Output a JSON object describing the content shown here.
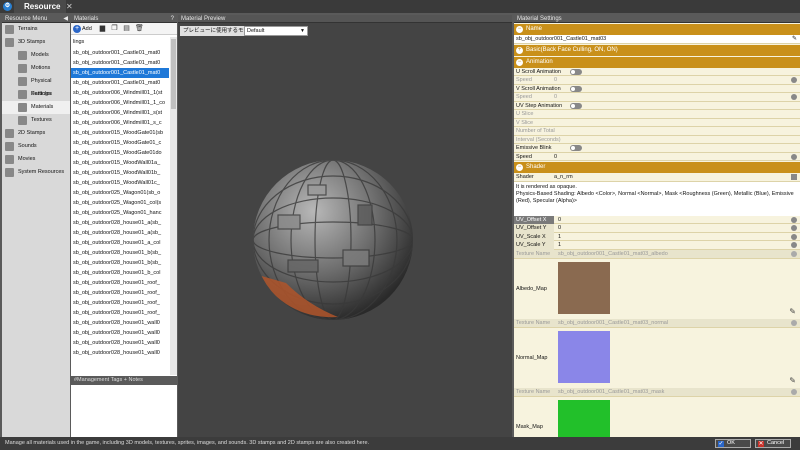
{
  "window": {
    "tab_title": "Resource",
    "close_glyph": "✕"
  },
  "resource_menu": {
    "title": "Resource Menu",
    "items": [
      {
        "label": "Terrains",
        "icon": "terrain-icon",
        "level": 0
      },
      {
        "label": "3D Stamps",
        "icon": "stamp-3d-icon",
        "level": 0
      },
      {
        "label": "Models",
        "icon": "model-icon",
        "level": 1
      },
      {
        "label": "Motions",
        "icon": "motion-icon",
        "level": 1
      },
      {
        "label": "Physical Settings",
        "icon": "physics-icon",
        "level": 1
      },
      {
        "label": "Particles",
        "icon": "particle-icon",
        "level": 1
      },
      {
        "label": "Materials",
        "icon": "material-icon",
        "level": 1,
        "selected": true
      },
      {
        "label": "Textures",
        "icon": "texture-icon",
        "level": 1
      },
      {
        "label": "2D Stamps",
        "icon": "stamp-2d-icon",
        "level": 0
      },
      {
        "label": "Sounds",
        "icon": "sound-icon",
        "level": 0
      },
      {
        "label": "Movies",
        "icon": "movie-icon",
        "level": 0
      },
      {
        "label": "System Resources",
        "icon": "system-icon",
        "level": 0
      }
    ]
  },
  "materials": {
    "title": "Materials",
    "help": "?",
    "add_label": "Add",
    "search_value": "lings",
    "items": [
      "sb_obj_outdoor001_Castle01_mat0",
      "sb_obj_outdoor001_Castle01_mat0",
      "sb_obj_outdoor001_Castle01_mat0",
      "sb_obj_outdoor001_Castle01_mat0",
      "sb_obj_outdoor006_Windmill01_1(st",
      "sb_obj_outdoor006_Windmill01_1_co",
      "sb_obj_outdoor006_Windmill01_s(st",
      "sb_obj_outdoor006_Windmill01_s_c",
      "sb_obj_outdoor015_WoodGate01(sb",
      "sb_obj_outdoor015_WoodGate01_c",
      "sb_obj_outdoor015_WoodGate01do",
      "sb_obj_outdoor015_WoodWall01a_",
      "sb_obj_outdoor015_WoodWall01b_",
      "sb_obj_outdoor015_WoodWall01c_",
      "sb_obj_outdoor025_Wagon01(sb_o",
      "sb_obj_outdoor025_Wagon01_col(s",
      "sb_obj_outdoor025_Wagon01_hanc",
      "sb_obj_outdoor028_house01_a(sb_",
      "sb_obj_outdoor028_house01_a(sb_",
      "sb_obj_outdoor028_house01_a_col",
      "sb_obj_outdoor028_house01_b(sb_",
      "sb_obj_outdoor028_house01_b(sb_",
      "sb_obj_outdoor028_house01_b_col",
      "sb_obj_outdoor028_house01_roof_",
      "sb_obj_outdoor028_house01_roof_",
      "sb_obj_outdoor028_house01_roof_",
      "sb_obj_outdoor028_house01_roof_",
      "sb_obj_outdoor028_house01_wall0",
      "sb_obj_outdoor028_house01_wall0",
      "sb_obj_outdoor028_house01_wall0",
      "sb_obj_outdoor028_house01_wall0"
    ],
    "selected_index": 2,
    "tags_label": "#Management Tags + Notes"
  },
  "preview": {
    "title": "Material Preview",
    "model_label": "プレビューに使用するモデル",
    "model_value": "Default"
  },
  "settings": {
    "title": "Material Settings",
    "name_section": "Name",
    "name_value": "sb_obj_outdoor001_Castle01_mat03",
    "basic_section": "Basic(Back Face Culling, ON, ON)",
    "animation_section": "Animation",
    "animation_rows": [
      {
        "label": "U Scroll Animation",
        "toggle": true,
        "disabled": false,
        "value": ""
      },
      {
        "label": "Speed",
        "toggle": false,
        "disabled": true,
        "value": "0"
      },
      {
        "label": "V Scroll Animation",
        "toggle": true,
        "disabled": false,
        "value": ""
      },
      {
        "label": "Speed",
        "toggle": false,
        "disabled": true,
        "value": "0"
      },
      {
        "label": "UV Step Animation",
        "toggle": true,
        "disabled": false,
        "value": ""
      },
      {
        "label": "U Slice",
        "toggle": false,
        "disabled": true,
        "value": ""
      },
      {
        "label": "V Slice",
        "toggle": false,
        "disabled": true,
        "value": ""
      },
      {
        "label": "Number of Total",
        "toggle": false,
        "disabled": true,
        "value": ""
      },
      {
        "label": "Interval (Seconds)",
        "toggle": false,
        "disabled": true,
        "value": ""
      },
      {
        "label": "Emissive Blink",
        "toggle": true,
        "disabled": false,
        "value": ""
      },
      {
        "label": "Speed",
        "toggle": false,
        "disabled": false,
        "value": "0"
      }
    ],
    "shader_section": "Shader",
    "shader_label": "Shader",
    "shader_value": "a_n_rm",
    "shader_desc1": "It is rendered as opaque.",
    "shader_desc2": "Physics-Based Shading: Albedo <Color>, Normal <Normal>, Mask <Roughness (Green), Metallic (Blue), Emissive (Red), Specular (Alpha)>",
    "uv_rows": [
      {
        "label": "UV_Offset X",
        "value": "0"
      },
      {
        "label": "UV_Offset Y",
        "value": "0"
      },
      {
        "label": "UV_Scale X",
        "value": "1"
      },
      {
        "label": "UV_Scale Y",
        "value": "1"
      }
    ],
    "texture_name_label": "Texture Name",
    "textures": [
      {
        "name": "sb_obj_outdoor001_Castle01_mat03_albedo",
        "label": "Albedo_Map",
        "color": "#8a6a50"
      },
      {
        "name": "sb_obj_outdoor001_Castle01_mat03_normal",
        "label": "Normal_Map",
        "color": "#8a86e8"
      },
      {
        "name": "sb_obj_outdoor001_Castle01_mat03_mask",
        "label": "Mask_Map",
        "color": "#22c02a"
      }
    ]
  },
  "status": {
    "message": "Manage all materials used in the game, including 3D models, textures, sprites, images, and sounds. 3D stamps and 2D stamps are also created here.",
    "ok_label": "OK",
    "cancel_label": "Cancel"
  }
}
